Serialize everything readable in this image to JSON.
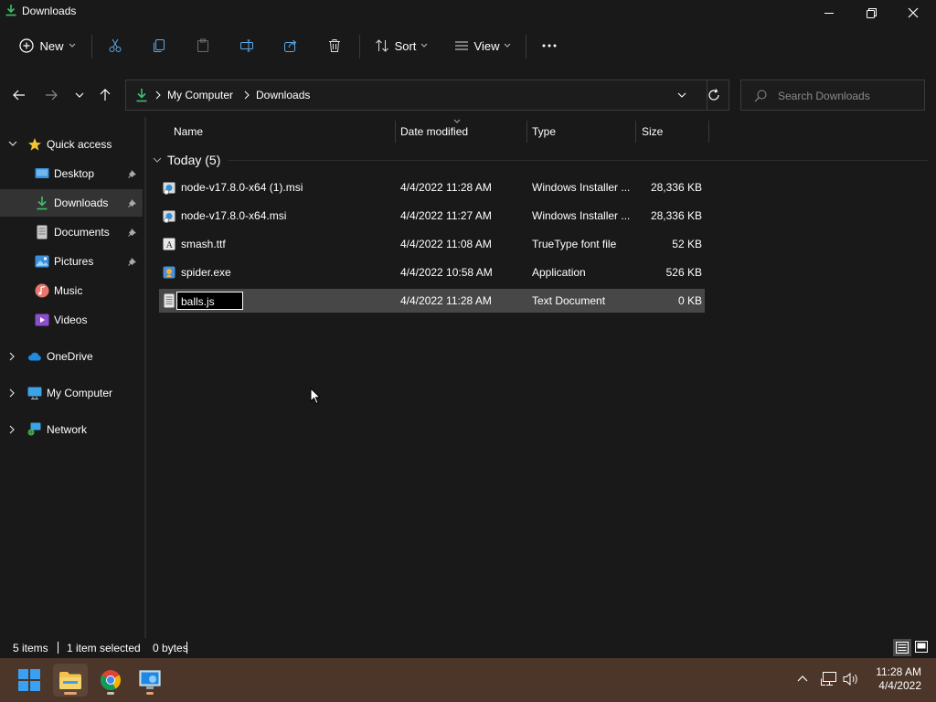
{
  "window": {
    "title": "Downloads",
    "icon": "download-icon",
    "controls": [
      "minimize-icon",
      "restore-icon",
      "close-icon"
    ]
  },
  "toolbar": {
    "new_label": "New",
    "sort_label": "Sort",
    "view_label": "View",
    "icons": [
      "new-icon",
      "cut-icon",
      "copy-icon",
      "paste-icon",
      "rename-icon",
      "share-icon",
      "delete-icon",
      "sort-icon",
      "view-icon",
      "more-icon"
    ]
  },
  "address": {
    "crumbs": [
      "My Computer",
      "Downloads"
    ],
    "search_placeholder": "Search Downloads"
  },
  "sidebar": {
    "quick_access": "Quick access",
    "items": [
      {
        "label": "Desktop",
        "icon": "desktop-icon",
        "pinned": true
      },
      {
        "label": "Downloads",
        "icon": "download-icon",
        "pinned": true,
        "selected": true
      },
      {
        "label": "Documents",
        "icon": "documents-icon",
        "pinned": true
      },
      {
        "label": "Pictures",
        "icon": "pictures-icon",
        "pinned": true
      },
      {
        "label": "Music",
        "icon": "music-icon",
        "pinned": false
      },
      {
        "label": "Videos",
        "icon": "videos-icon",
        "pinned": false
      }
    ],
    "roots": [
      {
        "label": "OneDrive",
        "icon": "cloud-icon"
      },
      {
        "label": "My Computer",
        "icon": "computer-icon"
      },
      {
        "label": "Network",
        "icon": "network-icon"
      }
    ]
  },
  "columns": {
    "name": "Name",
    "date": "Date modified",
    "type": "Type",
    "size": "Size"
  },
  "group": {
    "label": "Today (5)"
  },
  "files": [
    {
      "name": "node-v17.8.0-x64 (1).msi",
      "date": "4/4/2022 11:28 AM",
      "type": "Windows Installer ...",
      "size": "28,336 KB",
      "icon": "msi-icon"
    },
    {
      "name": "node-v17.8.0-x64.msi",
      "date": "4/4/2022 11:27 AM",
      "type": "Windows Installer ...",
      "size": "28,336 KB",
      "icon": "msi-icon"
    },
    {
      "name": "smash.ttf",
      "date": "4/4/2022 11:08 AM",
      "type": "TrueType font file",
      "size": "52 KB",
      "icon": "font-icon"
    },
    {
      "name": "spider.exe",
      "date": "4/4/2022 10:58 AM",
      "type": "Application",
      "size": "526 KB",
      "icon": "exe-icon"
    },
    {
      "name": "balls.js",
      "date": "4/4/2022 11:28 AM",
      "type": "Text Document",
      "size": "0 KB",
      "icon": "text-file-icon",
      "renaming": true
    }
  ],
  "status": {
    "items": "5 items",
    "selected": "1 item selected",
    "bytes": "0 bytes"
  },
  "taskbar": {
    "time": "11:28 AM",
    "date": "4/4/2022",
    "apps": [
      "start-icon",
      "file-explorer-icon",
      "chrome-icon",
      "installer-icon"
    ],
    "tray": [
      "chevron-up-icon",
      "network-tray-icon",
      "volume-icon"
    ]
  }
}
